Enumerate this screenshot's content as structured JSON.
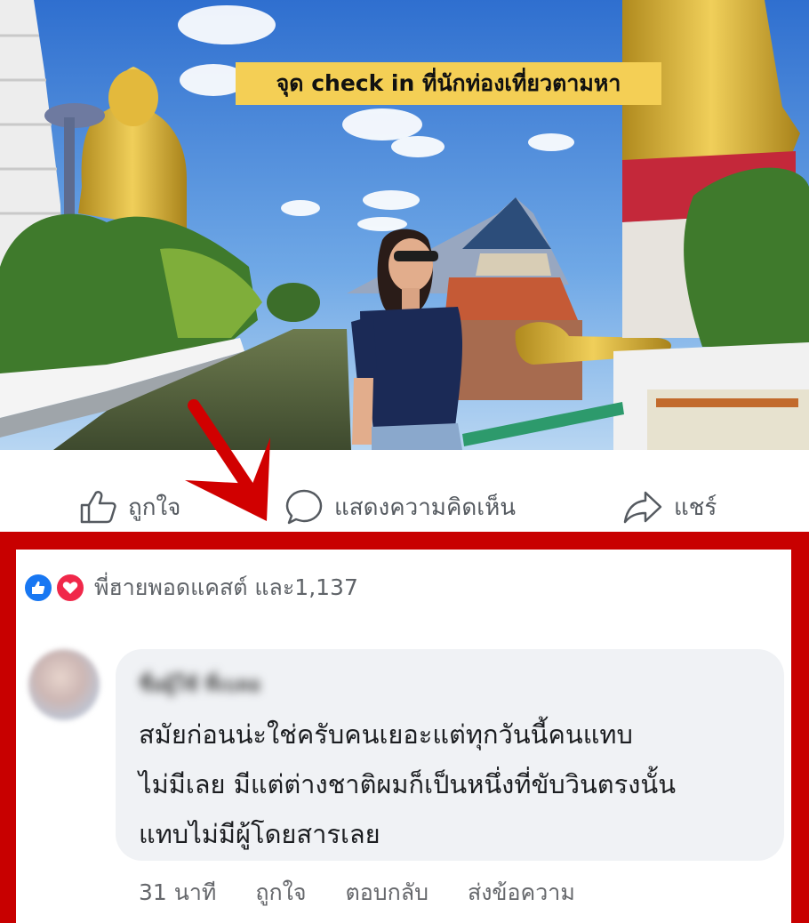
{
  "post": {
    "photo_caption": "จุด check in ที่นักท่องเที่ยวตามหา",
    "photo_icon": "temple-photo"
  },
  "actions": {
    "like_label": "ถูกใจ",
    "comment_label": "แสดงความคิดเห็น",
    "share_label": "แชร์"
  },
  "reactions": {
    "summary": "พี่ฮายพอดแคสต์ และ1,137",
    "icons": [
      "like-icon",
      "love-icon"
    ]
  },
  "comment": {
    "author": "ชื่อผู้ใช้ ที่เบลอ",
    "lines": [
      "สมัยก่อนน่ะใช่ครับคนเยอะแต่ทุกวันนี้คนแทบ",
      "ไม่มีเลย มีแต่ต่างชาติผมก็เป็นหนึ่งที่ขับวินตรงนั้น",
      "แทบไม่มีผู้โดยสารเลย"
    ],
    "time": "31 นาที",
    "like_label": "ถูกใจ",
    "reply_label": "ตอบกลับ",
    "message_label": "ส่งข้อความ"
  },
  "colors": {
    "highlight_frame": "#c80000",
    "banner": "#f4cf55",
    "bubble": "#f0f2f5",
    "like_blue": "#1877f2",
    "love_red": "#f0284a"
  }
}
